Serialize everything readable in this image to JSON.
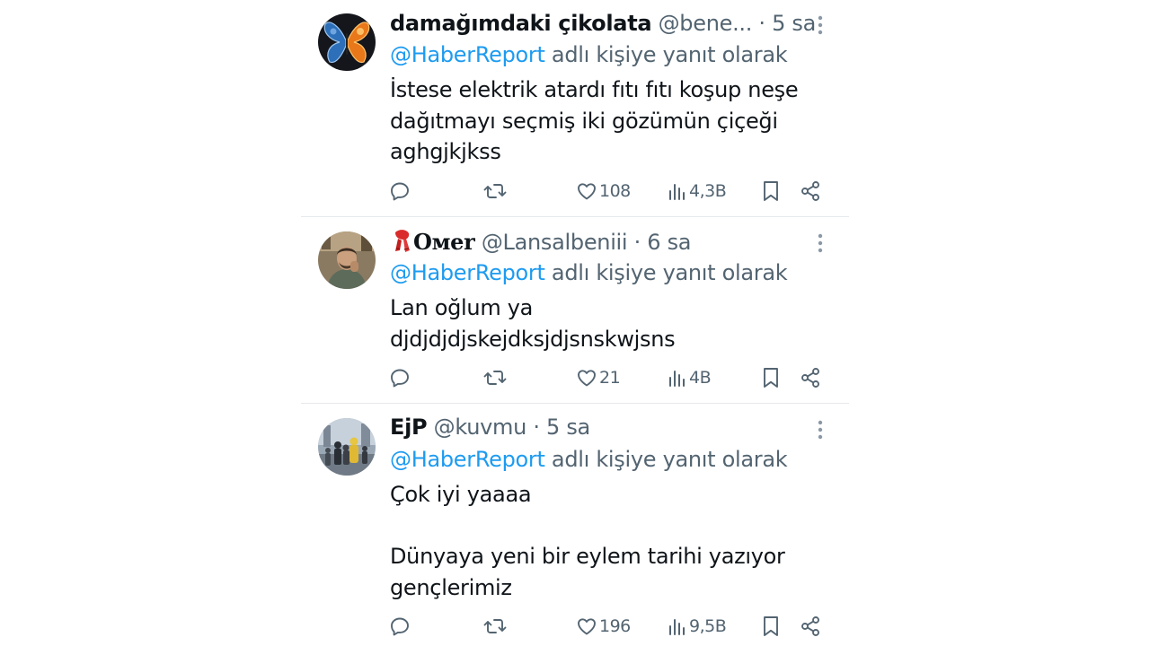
{
  "tweets": [
    {
      "name": "damağımdaki çikolata",
      "handle": "@bene...",
      "dot": " · ",
      "time": "5 sa",
      "reply_mention": "@HaberReport",
      "reply_suffix": " adlı kişiye yanıt olarak",
      "body_lines": [
        "İstese elektrik atardı fıtı fıtı koşup neşe",
        "dağıtmayı seçmiş iki gözümün çiçeği",
        "aghgjkjkss"
      ],
      "likes": "108",
      "views": "4,3B",
      "avatar_icon": "butterfly-icon"
    },
    {
      "name_icon": "scarf-emoji",
      "name": "Oмer",
      "handle": "@Lansalbeniii",
      "dot": " · ",
      "time": "6 sa",
      "reply_mention": "@HaberReport",
      "reply_suffix": " adlı kişiye yanıt olarak",
      "body_lines": [
        "Lan oğlum ya",
        "djdjdjdjskejdksjdjsnskwjsns"
      ],
      "likes": "21",
      "views": "4B",
      "avatar_icon": "man-portrait-icon"
    },
    {
      "name": "EjP",
      "handle": "@kuvmu",
      "dot": " · ",
      "time": "5 sa",
      "reply_mention": "@HaberReport",
      "reply_suffix": " adlı kişiye yanıt olarak",
      "body_lines": [
        "Çok iyi yaaaa",
        "",
        "Dünyaya yeni bir eylem tarihi yazıyor",
        "gençlerimiz"
      ],
      "likes": "196",
      "views": "9,5B",
      "avatar_icon": "crowd-photo-icon"
    }
  ],
  "colors": {
    "text": "#0f1419",
    "secondary": "#536471",
    "mention": "#1d9bf0",
    "divider": "#e6e9ec"
  }
}
